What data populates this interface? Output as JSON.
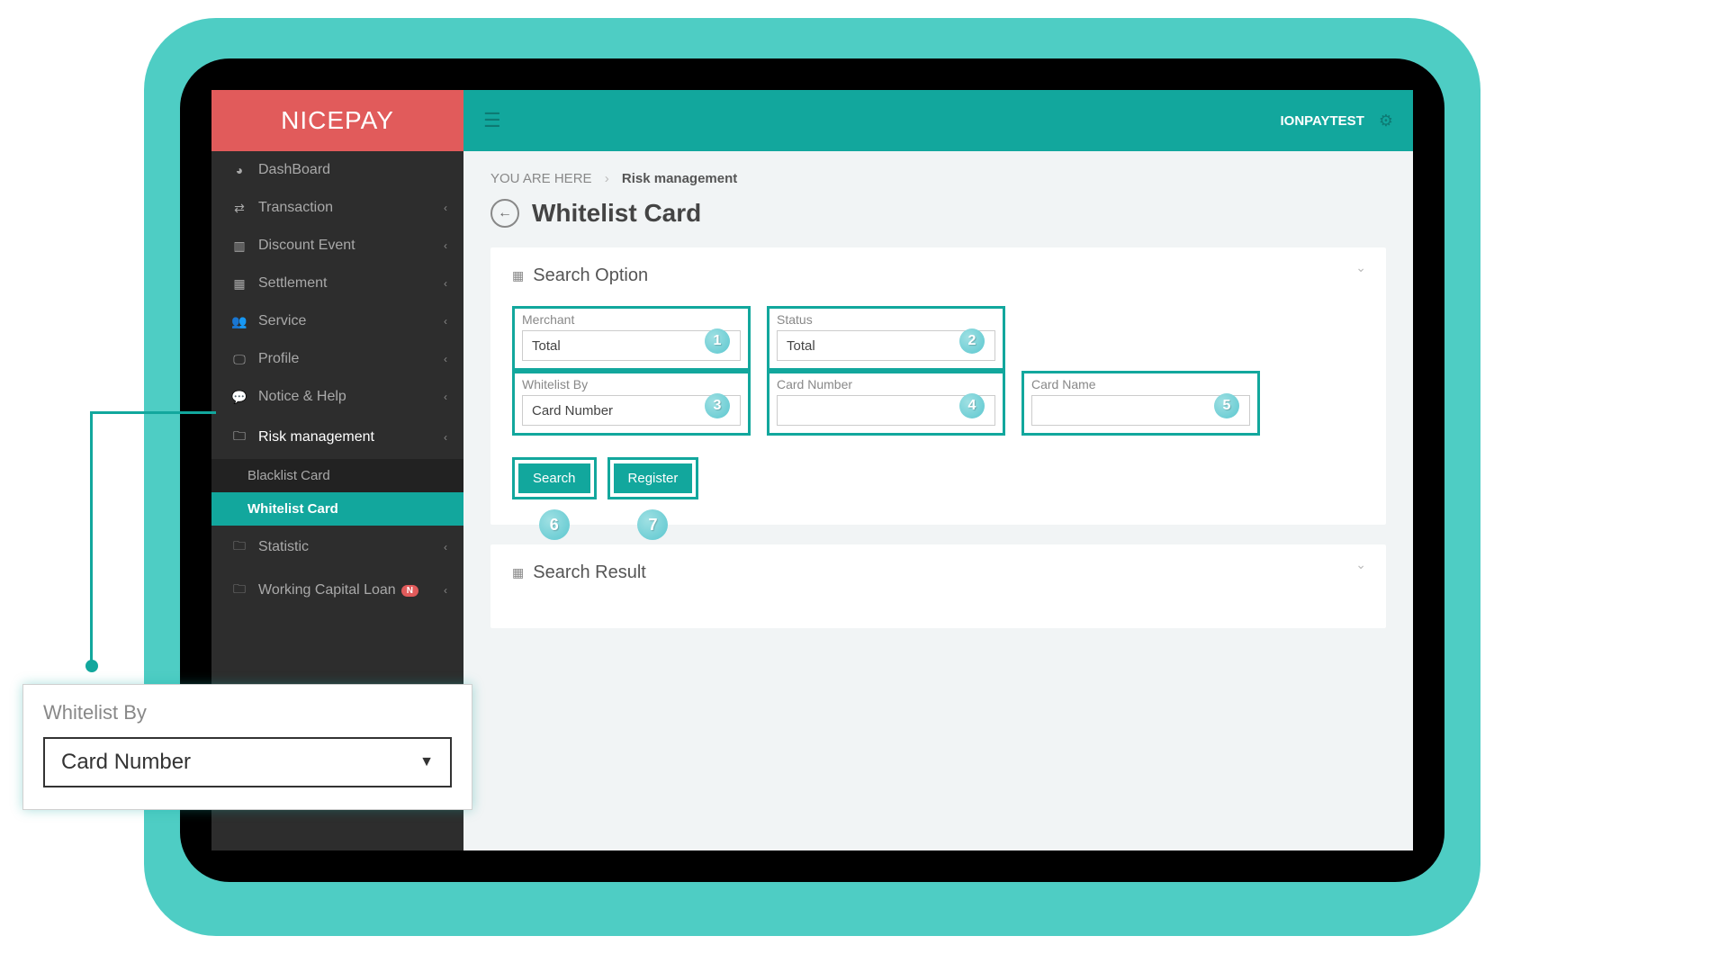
{
  "brand": "NICEPAY",
  "user": "IONPAYTEST",
  "breadcrumb": {
    "prefix": "YOU ARE HERE",
    "current": "Risk management"
  },
  "page_title": "Whitelist Card",
  "sidebar": {
    "items": [
      {
        "label": "DashBoard",
        "icon": "dashboard",
        "expandable": false
      },
      {
        "label": "Transaction",
        "icon": "exchange",
        "expandable": true
      },
      {
        "label": "Discount Event",
        "icon": "bars",
        "expandable": true
      },
      {
        "label": "Settlement",
        "icon": "calendar",
        "expandable": true
      },
      {
        "label": "Service",
        "icon": "users",
        "expandable": true
      },
      {
        "label": "Profile",
        "icon": "monitor",
        "expandable": true
      },
      {
        "label": "Notice & Help",
        "icon": "chat",
        "expandable": true
      },
      {
        "label": "Risk management",
        "icon": "folder",
        "expandable": true,
        "active": true,
        "children": [
          {
            "label": "Blacklist Card"
          },
          {
            "label": "Whitelist Card",
            "selected": true
          }
        ]
      },
      {
        "label": "Statistic",
        "icon": "folder",
        "expandable": true
      },
      {
        "label": "Working Capital Loan",
        "icon": "folder",
        "expandable": true,
        "badge": "N"
      }
    ]
  },
  "panels": {
    "search_option": {
      "title": "Search Option",
      "fields": {
        "merchant": {
          "label": "Merchant",
          "value": "Total",
          "badge": "1",
          "type": "select"
        },
        "status": {
          "label": "Status",
          "value": "Total",
          "badge": "2",
          "type": "select"
        },
        "whitelist_by": {
          "label": "Whitelist By",
          "value": "Card Number",
          "badge": "3",
          "type": "select"
        },
        "card_number": {
          "label": "Card Number",
          "value": "",
          "badge": "4",
          "type": "text"
        },
        "card_name": {
          "label": "Card Name",
          "value": "",
          "badge": "5",
          "type": "text"
        }
      },
      "buttons": {
        "search": {
          "label": "Search",
          "badge": "6"
        },
        "register": {
          "label": "Register",
          "badge": "7"
        }
      }
    },
    "search_result": {
      "title": "Search Result"
    }
  },
  "callout": {
    "label": "Whitelist By",
    "value": "Card Number"
  }
}
